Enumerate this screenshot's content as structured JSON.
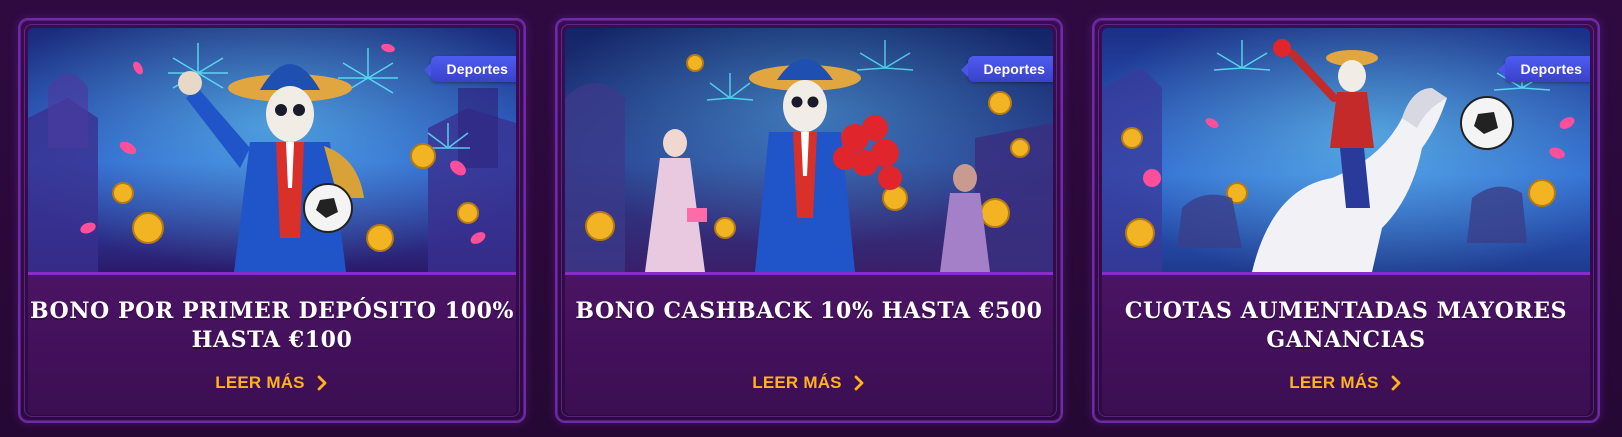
{
  "promos": [
    {
      "tag": "Deportes",
      "title": "BONO POR PRIMER DEPÓSITO 100% HASTA €100",
      "cta": "LEER MÁS"
    },
    {
      "tag": "Deportes",
      "title": "BONO CASHBACK 10% HASTA €500",
      "cta": "LEER MÁS"
    },
    {
      "tag": "Deportes",
      "title": "CUOTAS AUMENTADAS MAYORES GANANCIAS",
      "cta": "LEER MÁS"
    }
  ],
  "colors": {
    "page_bg": "#2a0a3a",
    "card_border": "#6e2aa8",
    "tag_bg": "#4d5cf0",
    "cta": "#ffb21a"
  }
}
